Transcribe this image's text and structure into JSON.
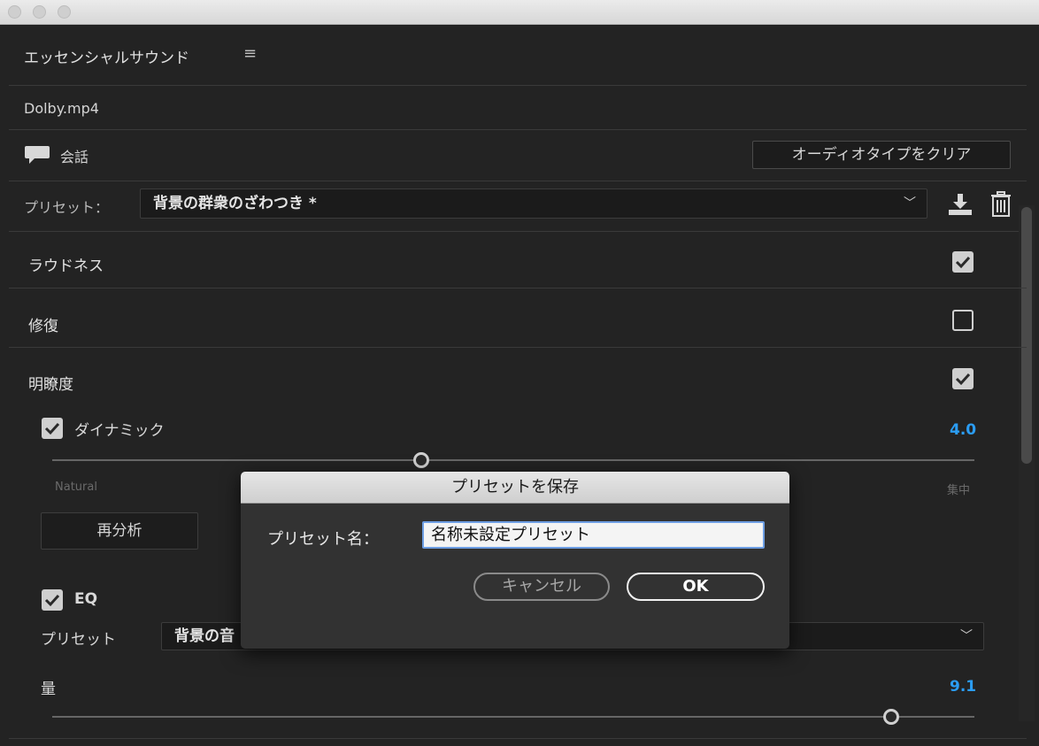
{
  "panel": {
    "title": "エッセンシャルサウンド",
    "menu_icon": "hamburger-menu-icon",
    "clip_name": "Dolby.mp4",
    "audio_type": {
      "icon": "speech-bubble-icon",
      "label": "会話",
      "clear_button": "オーディオタイプをクリア"
    },
    "preset": {
      "label": "プリセット：",
      "value": "背景の群衆のざわつき *",
      "save_icon": "download-icon",
      "delete_icon": "trash-icon"
    },
    "sections": {
      "loudness": {
        "label": "ラウドネス",
        "checked": true
      },
      "repair": {
        "label": "修復",
        "checked": false
      },
      "clarity": {
        "label": "明瞭度",
        "checked": true
      }
    },
    "dynamic": {
      "label": "ダイナミック",
      "checked": true,
      "value": "4.0",
      "value_fraction": 0.4,
      "min_label": "Natural",
      "max_label": "集中"
    },
    "reanalyze_button": "再分析",
    "eq": {
      "label": "EQ",
      "checked": true,
      "preset_label": "プリセット",
      "preset_value": "背景の音"
    },
    "amount": {
      "label": "量",
      "value": "9.1",
      "value_fraction": 0.91
    }
  },
  "dialog": {
    "title": "プリセットを保存",
    "name_label": "プリセット名：",
    "name_value": "名称未設定プリセット",
    "cancel_button": "キャンセル",
    "ok_button": "OK"
  },
  "colors": {
    "accent_blue": "#2b9df4",
    "panel_bg": "#232323"
  }
}
